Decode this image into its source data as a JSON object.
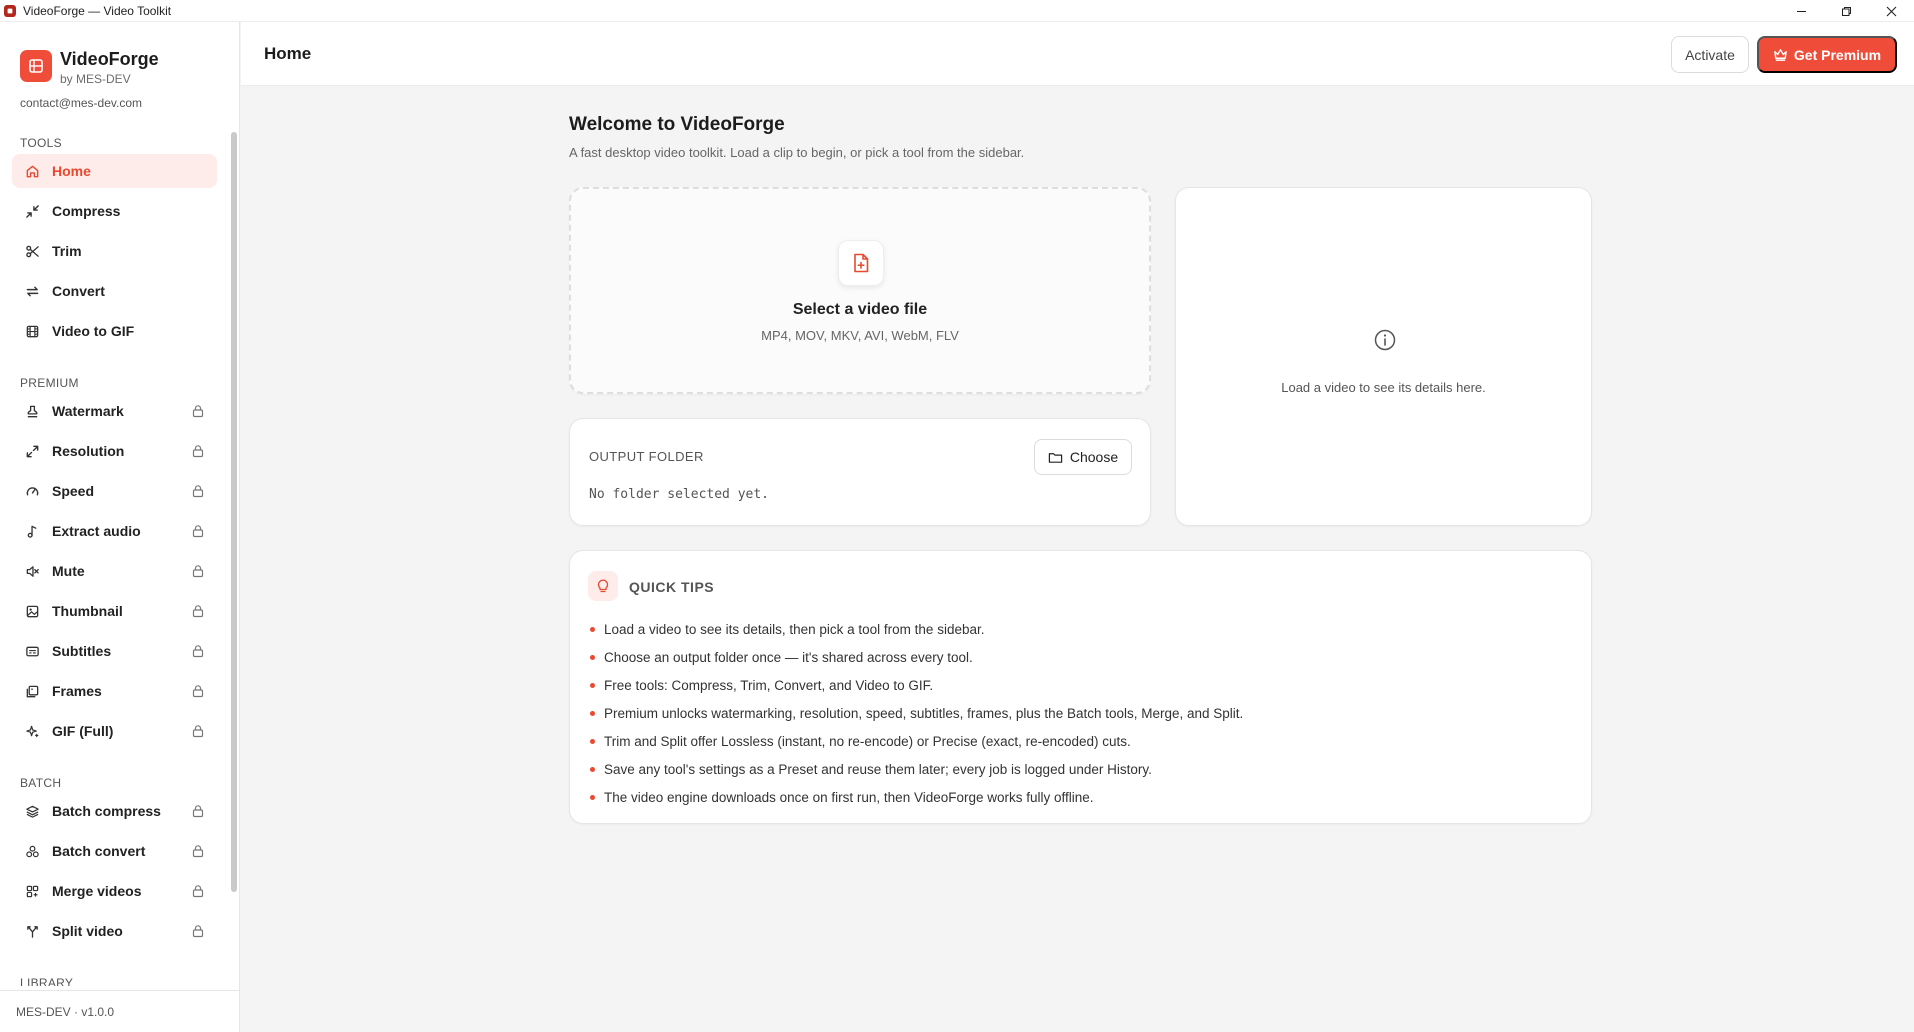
{
  "window": {
    "title": "VideoForge — Video Toolkit"
  },
  "sidebar": {
    "brand_name": "VideoForge",
    "brand_sub": "by MES-DEV",
    "contact": "contact@mes-dev.com",
    "sections": [
      {
        "label": "TOOLS",
        "items": [
          {
            "label": "Home",
            "icon": "home-icon",
            "locked": false,
            "active": true
          },
          {
            "label": "Compress",
            "icon": "compress-icon",
            "locked": false,
            "active": false
          },
          {
            "label": "Trim",
            "icon": "scissors-icon",
            "locked": false,
            "active": false
          },
          {
            "label": "Convert",
            "icon": "convert-icon",
            "locked": false,
            "active": false
          },
          {
            "label": "Video to GIF",
            "icon": "film-icon",
            "locked": false,
            "active": false
          }
        ]
      },
      {
        "label": "PREMIUM",
        "items": [
          {
            "label": "Watermark",
            "icon": "stamp-icon",
            "locked": true
          },
          {
            "label": "Resolution",
            "icon": "expand-icon",
            "locked": true
          },
          {
            "label": "Speed",
            "icon": "gauge-icon",
            "locked": true
          },
          {
            "label": "Extract audio",
            "icon": "music-note-icon",
            "locked": true
          },
          {
            "label": "Mute",
            "icon": "mute-icon",
            "locked": true
          },
          {
            "label": "Thumbnail",
            "icon": "image-icon",
            "locked": true
          },
          {
            "label": "Subtitles",
            "icon": "subtitles-icon",
            "locked": true
          },
          {
            "label": "Frames",
            "icon": "frames-icon",
            "locked": true
          },
          {
            "label": "GIF (Full)",
            "icon": "sparkles-icon",
            "locked": true
          }
        ]
      },
      {
        "label": "BATCH",
        "items": [
          {
            "label": "Batch compress",
            "icon": "layers-icon",
            "locked": true
          },
          {
            "label": "Batch convert",
            "icon": "batch-convert-icon",
            "locked": true
          },
          {
            "label": "Merge videos",
            "icon": "merge-icon",
            "locked": true
          },
          {
            "label": "Split video",
            "icon": "split-icon",
            "locked": true
          }
        ]
      },
      {
        "label": "LIBRARY",
        "items": []
      }
    ],
    "version": "MES-DEV · v1.0.0"
  },
  "header": {
    "title": "Home",
    "activate_label": "Activate",
    "premium_label": "Get Premium"
  },
  "main": {
    "welcome_title": "Welcome to VideoForge",
    "welcome_sub": "A fast desktop video toolkit. Load a clip to begin, or pick a tool from the sidebar.",
    "dropzone": {
      "title": "Select a video file",
      "formats": "MP4, MOV, MKV, AVI, WebM, FLV"
    },
    "details": {
      "empty_text": "Load a video to see its details here."
    },
    "output": {
      "label": "OUTPUT FOLDER",
      "choose_label": "Choose",
      "value": "No folder selected yet."
    },
    "tips": {
      "title": "QUICK TIPS",
      "items": [
        "Load a video to see its details, then pick a tool from the sidebar.",
        "Choose an output folder once — it's shared across every tool.",
        "Free tools: Compress, Trim, Convert, and Video to GIF.",
        "Premium unlocks watermarking, resolution, speed, subtitles, frames, plus the Batch tools, Merge, and Split.",
        "Trim and Split offer Lossless (instant, no re-encode) or Precise (exact, re-encoded) cuts.",
        "Save any tool's settings as a Preset and reuse them later; every job is logged under History.",
        "The video engine downloads once on first run, then VideoForge works fully offline."
      ]
    }
  },
  "colors": {
    "accent": "#ef4d3a",
    "accent_soft": "#fdecea"
  }
}
